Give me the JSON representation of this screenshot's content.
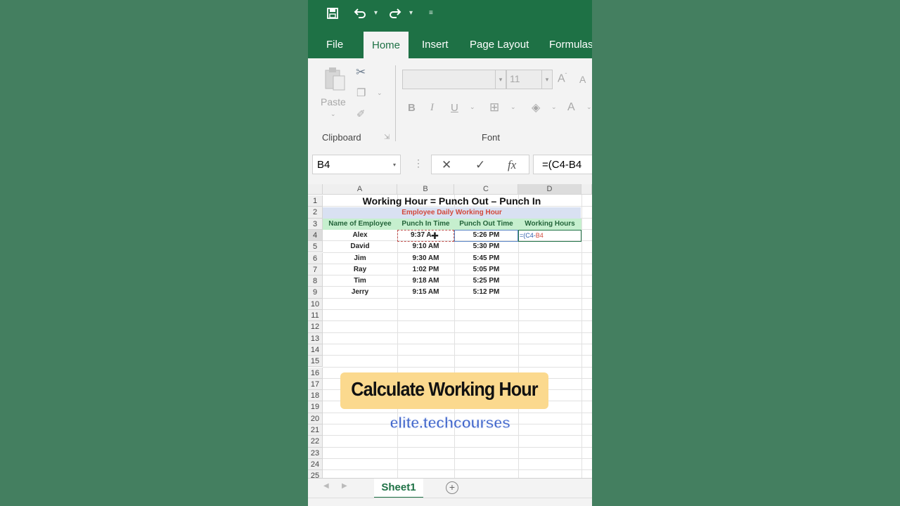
{
  "qat": {
    "save_icon": "save-icon",
    "undo_icon": "undo-icon",
    "redo_icon": "redo-icon"
  },
  "tabs": [
    {
      "label": "File"
    },
    {
      "label": "Home"
    },
    {
      "label": "Insert"
    },
    {
      "label": "Page Layout"
    },
    {
      "label": "Formulas"
    }
  ],
  "ribbon": {
    "paste_label": "Paste",
    "clipboard_label": "Clipboard",
    "font_label": "Font",
    "font_size": "11"
  },
  "formula_bar": {
    "name_box": "B4",
    "formula": "=(C4-B4"
  },
  "grid": {
    "columns": [
      "A",
      "B",
      "C",
      "D"
    ],
    "title": "Working Hour = Punch Out – Punch In",
    "subtitle": "Employee Daily Working Hour",
    "headers": [
      "Name of Employee",
      "Punch In Time",
      "Punch Out Time",
      "Working Hours"
    ],
    "rows": [
      {
        "name": "Alex",
        "in": "9:37 A",
        "out": "5:26 PM"
      },
      {
        "name": "David",
        "in": "9:10 AM",
        "out": "5:30 PM"
      },
      {
        "name": "Jim",
        "in": "9:30 AM",
        "out": "5:45 PM"
      },
      {
        "name": "Ray",
        "in": "1:02 PM",
        "out": "5:05 PM"
      },
      {
        "name": "Tim",
        "in": "9:18 AM",
        "out": "5:25 PM"
      },
      {
        "name": "Jerry",
        "in": "9:15 AM",
        "out": "5:12 PM"
      }
    ],
    "edit_prefix": "=(C4-",
    "edit_ref": "B4",
    "row_numbers": [
      "1",
      "2",
      "3",
      "4",
      "5",
      "6",
      "7",
      "8",
      "9",
      "10",
      "11",
      "12",
      "13",
      "14",
      "15",
      "16",
      "17",
      "18",
      "19",
      "20",
      "21",
      "22",
      "23",
      "24",
      "25"
    ]
  },
  "sheet": {
    "tab_label": "Sheet1"
  },
  "overlay": {
    "banner": "Calculate Working Hour",
    "watermark": "elite.techcourses"
  }
}
